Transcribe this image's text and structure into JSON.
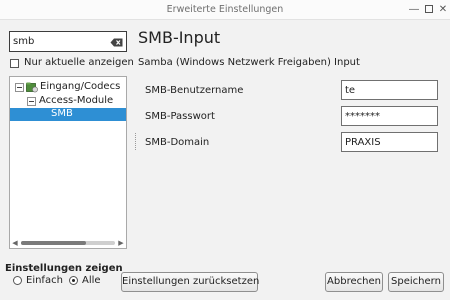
{
  "window": {
    "title": "Erweiterte Einstellungen"
  },
  "search": {
    "value": "smb"
  },
  "filter": {
    "only_current_label": "Nur aktuelle anzeigen",
    "checked": false
  },
  "tree": {
    "items": [
      {
        "label": "Eingang/Codecs",
        "level": 0,
        "expanded": true,
        "icon": "folder-icon"
      },
      {
        "label": "Access-Module",
        "level": 1,
        "expanded": true
      },
      {
        "label": "SMB",
        "level": 2,
        "selected": true
      }
    ]
  },
  "main": {
    "title": "SMB-Input",
    "description": "Samba (Windows Netzwerk Freigaben) Input",
    "fields": [
      {
        "label": "SMB-Benutzername",
        "value": "te"
      },
      {
        "label": "SMB-Passwort",
        "value": "*******"
      },
      {
        "label": "SMB-Domain",
        "value": "PRAXIS"
      }
    ]
  },
  "footer": {
    "show_settings_label": "Einstellungen zeigen",
    "mode_simple": "Einfach",
    "mode_all": "Alle",
    "selected_mode": "Alle",
    "reset_button": "Einstellungen zurücksetzen",
    "cancel_button": "Abbrechen",
    "save_button": "Speichern"
  },
  "colors": {
    "selection": "#2e8fd4",
    "background": "#f2f2f2"
  }
}
